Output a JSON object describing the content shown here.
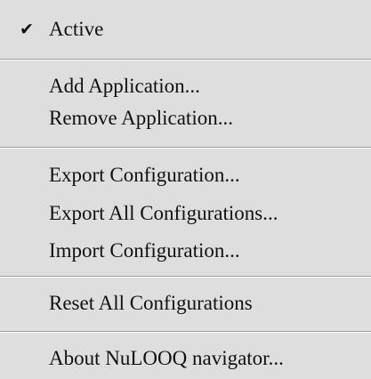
{
  "menu": {
    "items": [
      {
        "label": "Active",
        "checked": true,
        "check_icon": "checkmark-icon"
      },
      {
        "label": "Add Application..."
      },
      {
        "label": "Remove Application..."
      },
      {
        "label": "Export Configuration..."
      },
      {
        "label": "Export All Configurations..."
      },
      {
        "label": "Import Configuration..."
      },
      {
        "label": "Reset All Configurations"
      },
      {
        "label": "About NuLOOQ navigator..."
      }
    ],
    "check_glyph": "✔"
  }
}
